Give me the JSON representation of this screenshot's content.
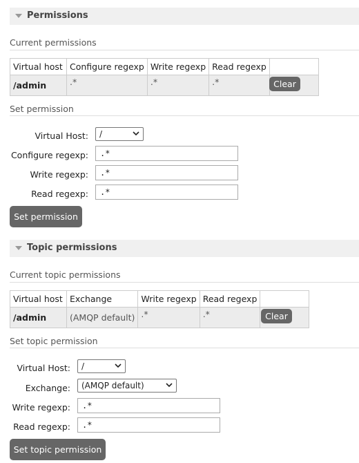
{
  "permissions": {
    "section_title": "Permissions",
    "current_title": "Current permissions",
    "table": {
      "headers": [
        "Virtual host",
        "Configure regexp",
        "Write regexp",
        "Read regexp"
      ],
      "rows": [
        {
          "vhost": "/admin",
          "configure": ".*",
          "write": ".*",
          "read": ".*",
          "clear_label": "Clear"
        }
      ]
    },
    "set_title": "Set permission",
    "form": {
      "vhost_label": "Virtual Host:",
      "vhost_value": "/",
      "configure_label": "Configure regexp:",
      "configure_value": ".*",
      "write_label": "Write regexp:",
      "write_value": ".*",
      "read_label": "Read regexp:",
      "read_value": ".*",
      "submit_label": "Set permission"
    }
  },
  "topic_permissions": {
    "section_title": "Topic permissions",
    "current_title": "Current topic permissions",
    "table": {
      "headers": [
        "Virtual host",
        "Exchange",
        "Write regexp",
        "Read regexp"
      ],
      "rows": [
        {
          "vhost": "/admin",
          "exchange": "(AMQP default)",
          "write": ".*",
          "read": ".*",
          "clear_label": "Clear"
        }
      ]
    },
    "set_title": "Set topic permission",
    "form": {
      "vhost_label": "Virtual Host:",
      "vhost_value": "/",
      "exchange_label": "Exchange:",
      "exchange_value": "(AMQP default)",
      "write_label": "Write regexp:",
      "write_value": ".*",
      "read_label": "Read regexp:",
      "read_value": ".*",
      "submit_label": "Set topic permission"
    }
  },
  "icons": {
    "collapse": "triangle-down-icon",
    "select": "chevron-down-icon"
  },
  "colors": {
    "button_bg": "#666666",
    "section_header_bg": "#f0f0f0",
    "row_bg": "#ececec"
  }
}
